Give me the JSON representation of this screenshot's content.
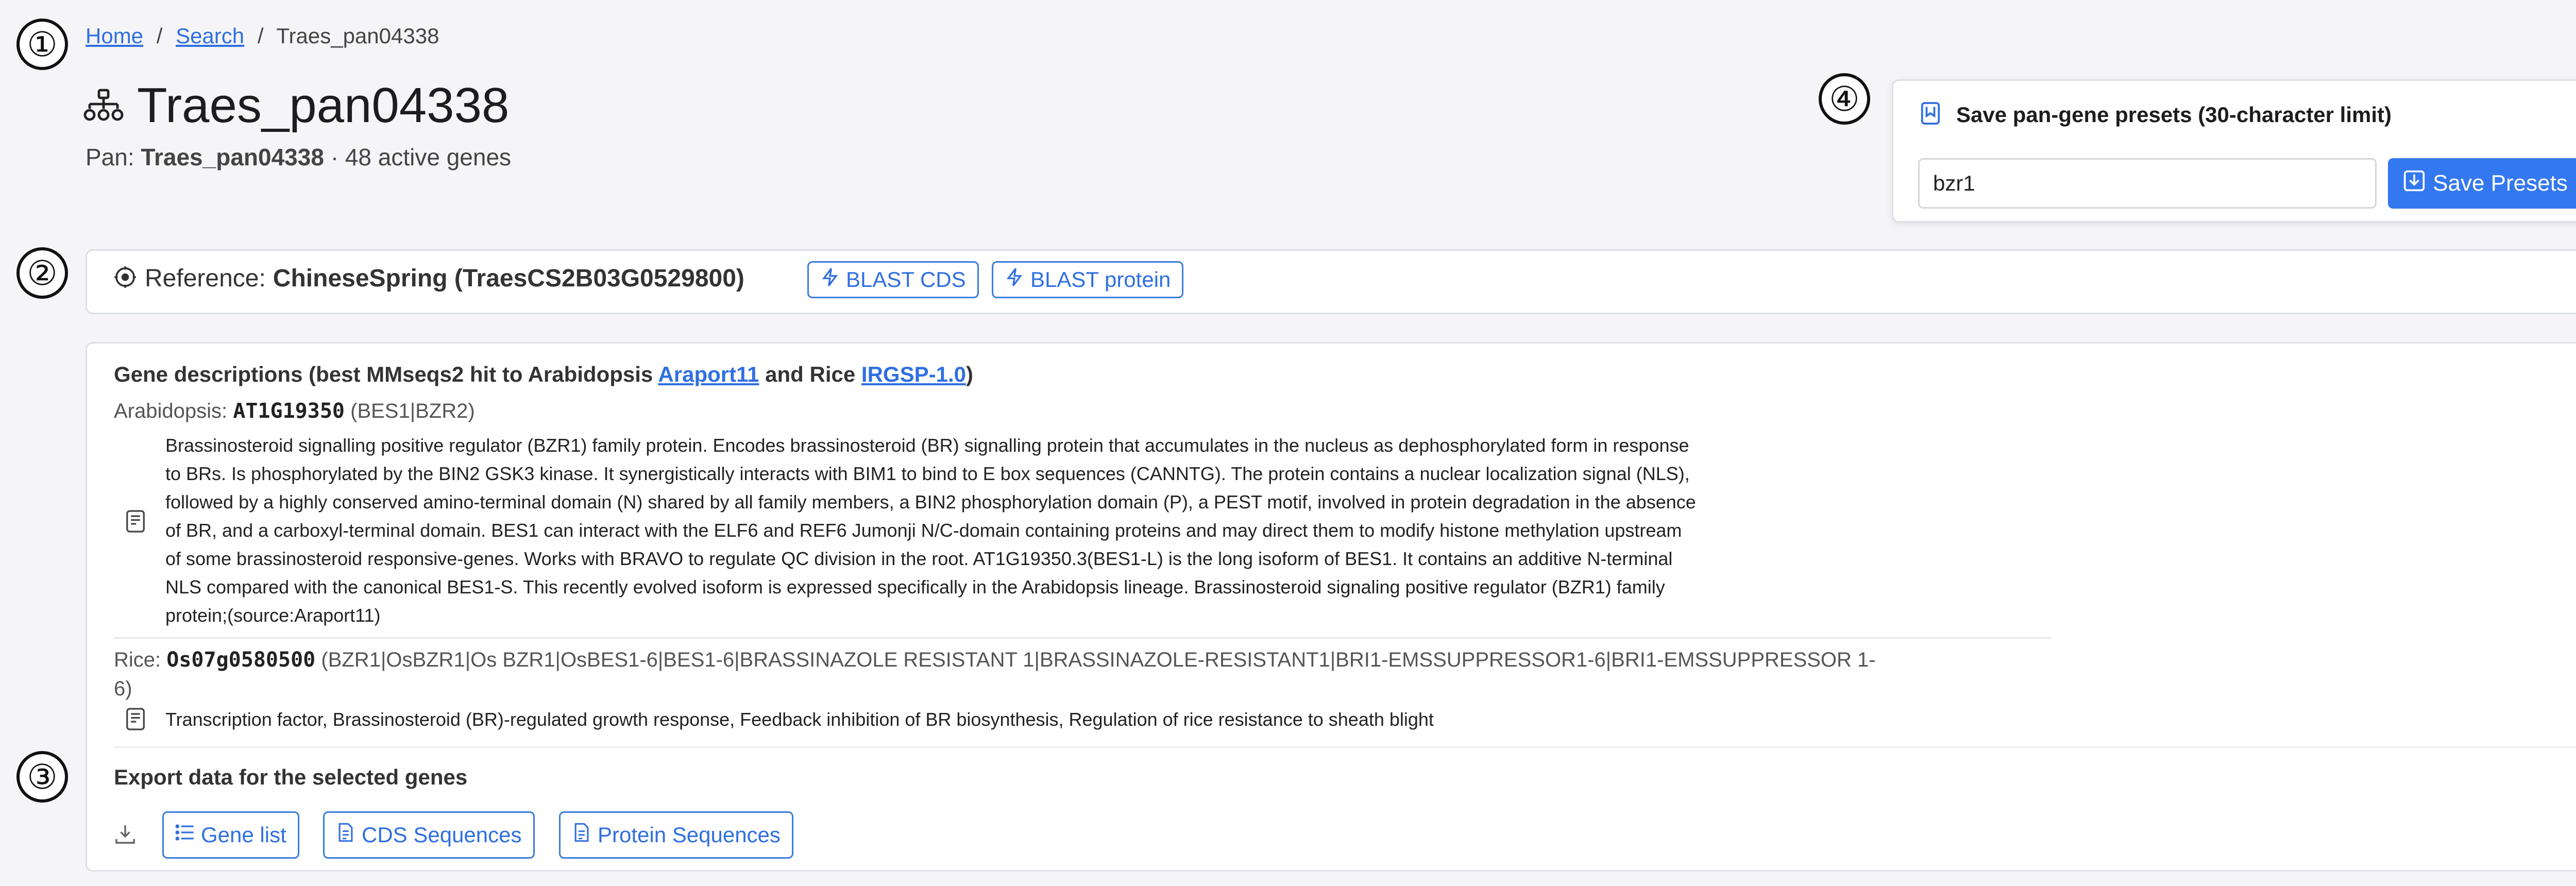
{
  "breadcrumb": {
    "home": "Home",
    "search": "Search",
    "current": "Traes_pan04338",
    "sep": "/"
  },
  "title": "Traes_pan04338",
  "subtitle": {
    "prefix": "Pan:",
    "pan_id": "Traes_pan04338",
    "suffix": "· 48 active genes"
  },
  "markers": [
    "①",
    "②",
    "③",
    "④"
  ],
  "presets": {
    "heading": "Save pan-gene presets (30-character limit)",
    "input_value": "bzr1",
    "button": "Save Presets"
  },
  "reference": {
    "label": "Reference:",
    "value": "ChineseSpring (TraesCS2B03G0529800)",
    "blast_cds": "BLAST CDS",
    "blast_protein": "BLAST protein"
  },
  "descriptions": {
    "heading_prefix": "Gene descriptions (best MMseqs2 hit to Arabidopsis",
    "araport_link": "Araport11",
    "heading_mid": "and Rice",
    "irgsp_link": "IRGSP-1.0",
    "heading_suffix": ")",
    "arabidopsis": {
      "label": "Arabidopsis:",
      "gene_id": "AT1G19350",
      "aliases": "(BES1|BZR2)",
      "lines": [
        "Brassinosteroid signalling positive regulator (BZR1) family protein. Encodes brassinosteroid (BR) signalling protein that accumulates in the nucleus as dephosphorylated form in response",
        "to BRs. Is phosphorylated by the BIN2 GSK3 kinase. It synergistically interacts with BIM1 to bind to E box sequences (CANNTG). The protein contains a nuclear localization signal (NLS),",
        "followed by a highly conserved amino-terminal domain (N) shared by all family members, a BIN2 phosphorylation domain (P), a PEST motif, involved in protein degradation in the absence",
        "of BR, and a carboxyl-terminal domain. BES1 can interact with the ELF6 and REF6 Jumonji N/C-domain containing proteins and may direct them to modify histone methylation upstream",
        "of some brassinosteroid responsive-genes. Works with BRAVO to regulate QC division in the root. AT1G19350.3(BES1-L) is the long isoform of BES1. It contains an additive N-terminal",
        "NLS compared with the canonical BES1-S. This recently evolved isoform is expressed specifically in the Arabidopsis lineage. Brassinosteroid signaling positive regulator (BZR1) family",
        "protein;(source:Araport11)"
      ]
    },
    "rice": {
      "label": "Rice:",
      "gene_id": "Os07g0580500",
      "aliases_line1": "(BZR1|OsBZR1|Os BZR1|OsBES1-6|BES1-6|BRASSINAZOLE RESISTANT 1|BRASSINAZOLE-RESISTANT1|BRI1-EMSSUPPRESSOR1-6|BRI1-EMSSUPPRESSOR 1-",
      "aliases_line2": "6)",
      "description": "Transcription factor, Brassinosteroid (BR)-regulated growth response, Feedback inhibition of BR biosynthesis, Regulation of rice resistance to sheath blight"
    }
  },
  "export": {
    "heading": "Export data for the selected genes",
    "gene_list": "Gene list",
    "cds": "CDS Sequences",
    "protein": "Protein Sequences"
  },
  "colors": {
    "accent": "#2f6fe0",
    "primary_button": "#3478f0",
    "border": "#dcdfe4"
  },
  "icons": [
    "hierarchy-icon",
    "bookmark-icon",
    "save-download-icon",
    "target-icon",
    "lightning-icon",
    "document-icon",
    "download-icon",
    "list-icon",
    "file-icon"
  ]
}
